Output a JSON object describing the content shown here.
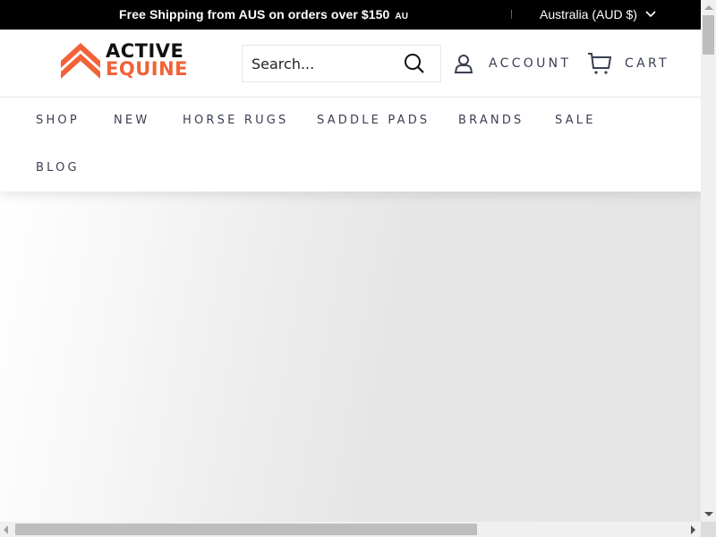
{
  "announcement": {
    "text": "Free Shipping from AUS on orders over $150",
    "currency_suffix": "AU"
  },
  "currency_selector": {
    "selected": "Australia (AUD $)",
    "icon": "chevron-down-icon"
  },
  "logo": {
    "line1": "ACTIVE",
    "line2": "EQUINE",
    "brand_color": "#f26237"
  },
  "search": {
    "placeholder": "Search...",
    "value": "",
    "icon": "search-icon"
  },
  "header_links": {
    "account_label": "ACCOUNT",
    "account_icon": "user-icon",
    "cart_label": "CART",
    "cart_icon": "cart-icon"
  },
  "nav": {
    "items": [
      {
        "label": "SHOP"
      },
      {
        "label": "NEW"
      },
      {
        "label": "HORSE RUGS"
      },
      {
        "label": "SADDLE PADS"
      },
      {
        "label": "BRANDS"
      },
      {
        "label": "SALE"
      },
      {
        "label": "BLOG"
      }
    ]
  },
  "colors": {
    "announcement_bg": "#000000",
    "nav_text": "#3a3f52",
    "accent": "#f26237"
  }
}
